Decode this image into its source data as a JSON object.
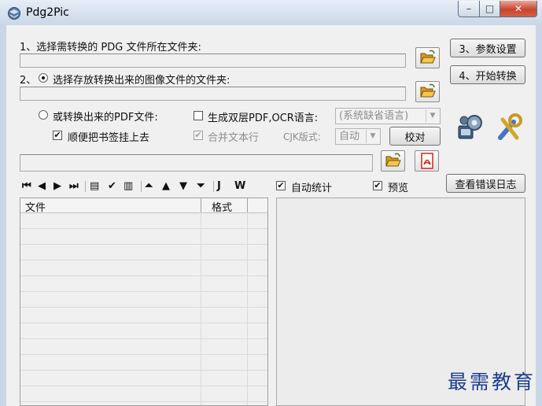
{
  "window": {
    "title": "Pdg2Pic"
  },
  "window_controls": {
    "minimize": "–",
    "maximize": "□",
    "close": "✕"
  },
  "step1": {
    "label": "1、选择需转换的 PDG 文件所在文件夹:",
    "value": ""
  },
  "step2": {
    "prefix": "2、",
    "label": "选择存放转换出来的图像文件的文件夹:",
    "value": "",
    "selected": true
  },
  "buttons": {
    "params": "3、参数设置",
    "start": "4、开始转换",
    "proofread": "校对",
    "error_log": "查看错误日志"
  },
  "pdf_option": {
    "label": "或转换出来的PDF文件:",
    "selected": false
  },
  "double_layer": {
    "label": "生成双层PDF,OCR语言:",
    "checked": false
  },
  "ocr_language": {
    "value": "(系统缺省语言)"
  },
  "bookmarks": {
    "label": "顺便把书签挂上去",
    "checked": true
  },
  "merge_lines": {
    "label": "合并文本行",
    "checked": true,
    "disabled": true
  },
  "cjk_layout": {
    "label": "CJK版式:",
    "value": "自动"
  },
  "pdf_path": {
    "value": ""
  },
  "toolbar": {
    "items": [
      {
        "glyph": "⏮",
        "name": "first"
      },
      {
        "glyph": "◀",
        "name": "prev"
      },
      {
        "glyph": "▶",
        "name": "next"
      },
      {
        "glyph": "⏭",
        "name": "last"
      },
      {
        "glyph": "▤",
        "name": "edit"
      },
      {
        "glyph": "✔",
        "name": "check"
      },
      {
        "glyph": "▥",
        "name": "export"
      },
      {
        "glyph": "⏶",
        "name": "top"
      },
      {
        "glyph": "▲",
        "name": "up"
      },
      {
        "glyph": "▼",
        "name": "down"
      },
      {
        "glyph": "⏷",
        "name": "bottom"
      },
      {
        "glyph": "J",
        "name": "j"
      },
      {
        "glyph": "W",
        "name": "w"
      }
    ]
  },
  "auto_stats": {
    "label": "自动统计",
    "checked": true
  },
  "preview_opt": {
    "label": "预览",
    "checked": true
  },
  "file_list": {
    "columns": [
      "文件",
      "格式"
    ],
    "rows": []
  },
  "watermark": {
    "text": "最需教育"
  },
  "colors": {
    "watermark": "#1c3d8e",
    "title_bar": "#c9d7e8",
    "close_button": "#c8452f"
  }
}
